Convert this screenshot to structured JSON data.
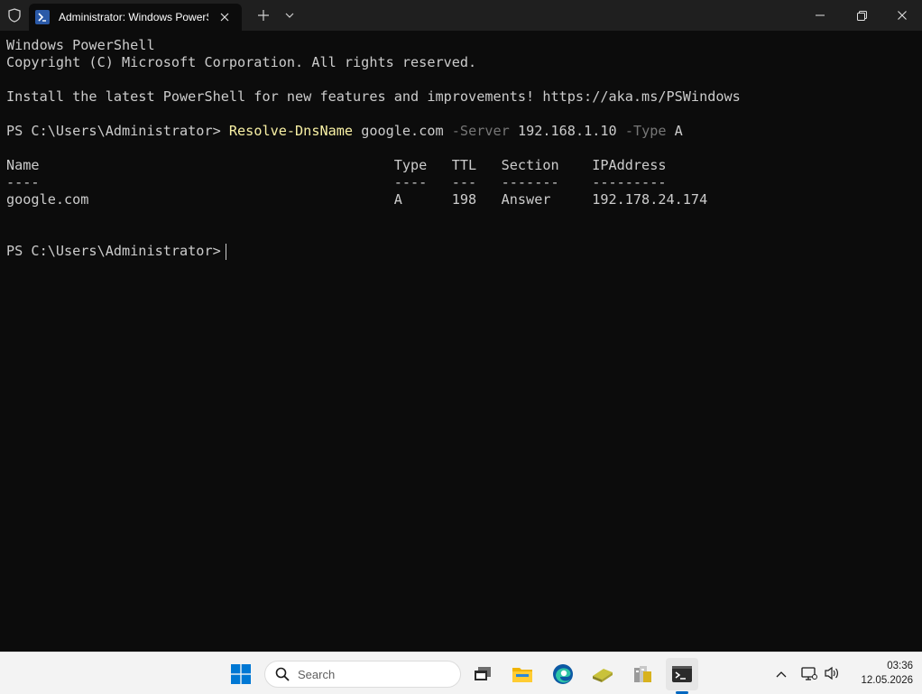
{
  "window": {
    "tab_title": "Administrator: Windows PowerShell",
    "icons": {
      "shield": "shield-icon",
      "tab": "powershell-icon",
      "close_tab": "close-icon",
      "new_tab": "plus-icon",
      "dropdown": "chevron-down-icon",
      "minimize": "minimize-icon",
      "maximize": "restore-icon",
      "close": "close-icon"
    }
  },
  "terminal": {
    "banner_1": "Windows PowerShell",
    "banner_2": "Copyright (C) Microsoft Corporation. All rights reserved.",
    "banner_3": "Install the latest PowerShell for new features and improvements! https://aka.ms/PSWindows",
    "prompt": "PS C:\\Users\\Administrator> ",
    "command": {
      "cmdlet": "Resolve-DnsName",
      "arg_1": " google.com ",
      "param_1": "-Server",
      "arg_2": " 192.168.1.10 ",
      "param_2": "-Type",
      "arg_3": " A"
    },
    "table_header": "Name                                           Type   TTL   Section    IPAddress",
    "table_divider": "----                                           ----   ---   -------    ---------",
    "table_row": "google.com                                     A      198   Answer     192.178.24.174",
    "prompt_2": "PS C:\\Users\\Administrator> ",
    "colors": {
      "background": "#0c0c0c",
      "text": "#cccccc",
      "cmdlet": "#f9f1a5",
      "parameter": "#767676"
    }
  },
  "taskbar": {
    "search_placeholder": "Search",
    "time": "03:36",
    "date": "12.05.2026",
    "icons": [
      "windows-start-icon",
      "search-icon",
      "task-view-icon",
      "file-explorer-icon",
      "edge-icon",
      "app-icon",
      "app-icon",
      "terminal-icon",
      "chevron-up-icon",
      "network-icon",
      "volume-icon"
    ]
  }
}
